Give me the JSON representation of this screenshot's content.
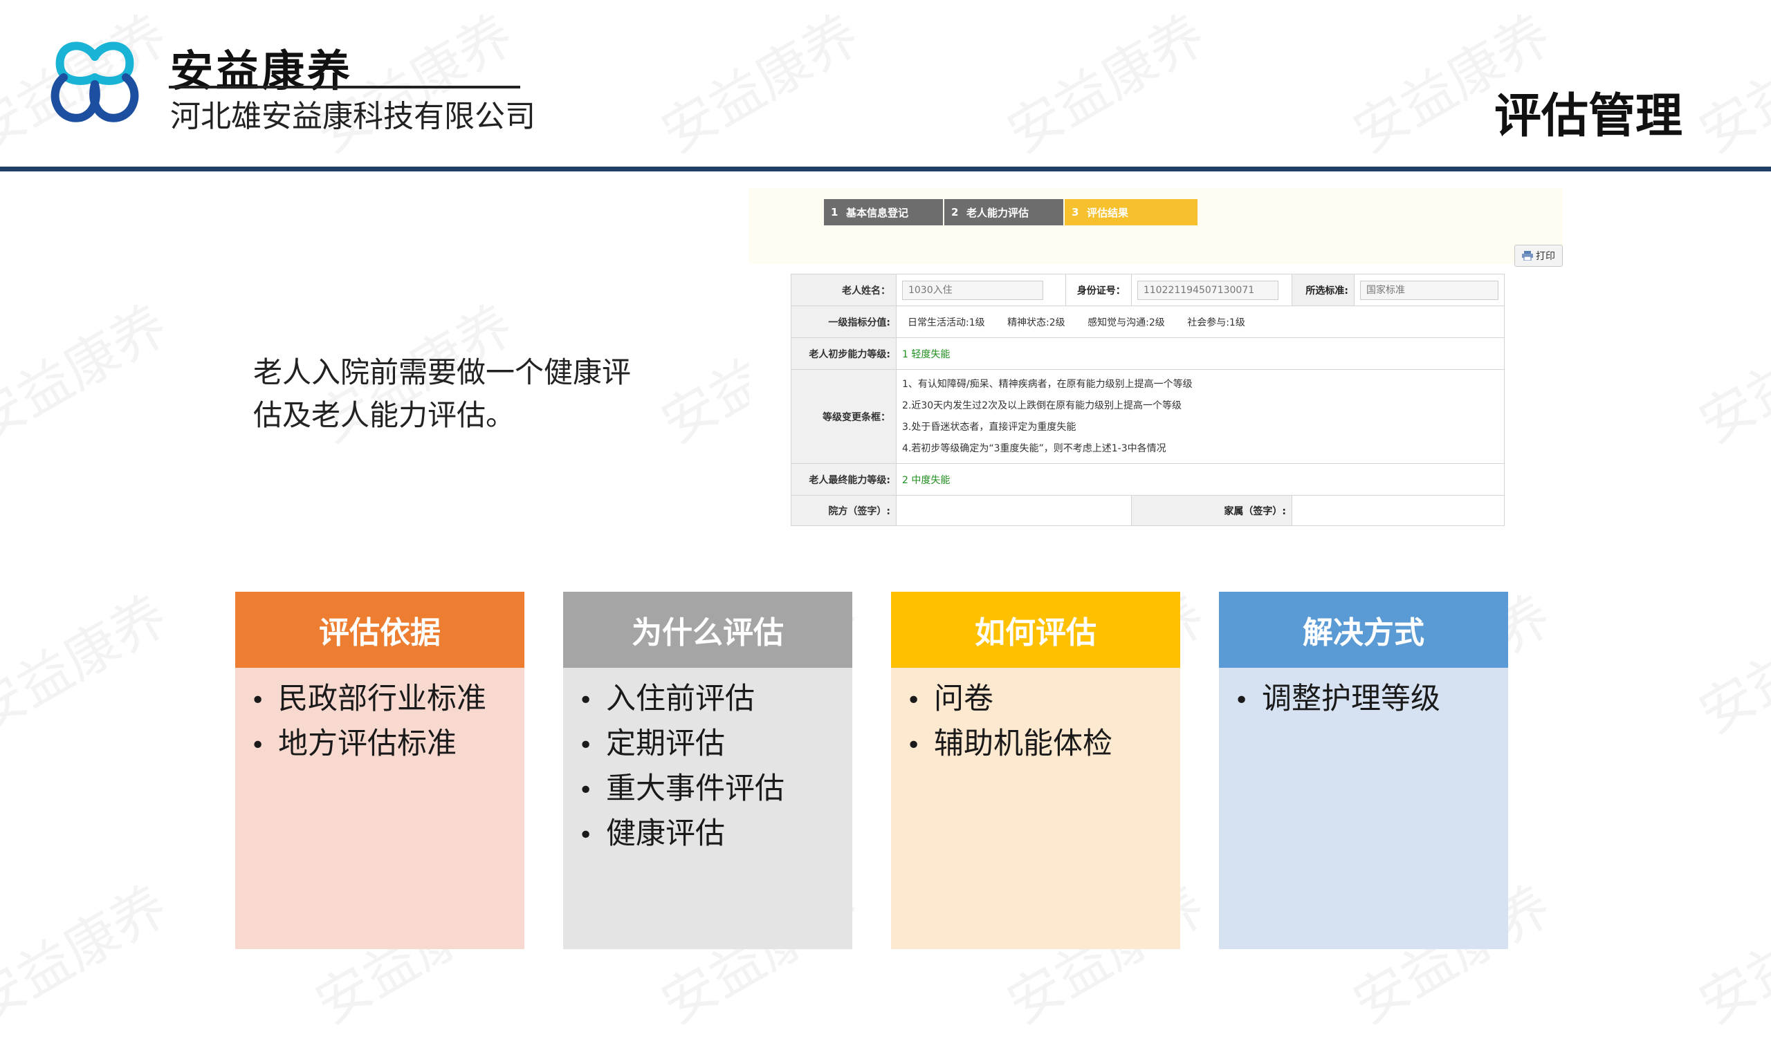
{
  "header": {
    "brand_name": "安益康养",
    "company": "河北雄安益康科技有限公司",
    "page_title": "评估管理",
    "logo_icon": "trefoil-heart-logo-icon",
    "divider_color": "#1f3f66"
  },
  "watermark": "安益康养",
  "intro": "老人入院前需要做一个健康评估及老人能力评估。",
  "screenshot": {
    "steps": [
      {
        "num": "1",
        "label": "基本信息登记",
        "color": "#6d6d6d"
      },
      {
        "num": "2",
        "label": "老人能力评估",
        "color": "#6d6d6d"
      },
      {
        "num": "3",
        "label": "评估结果",
        "color": "#f6c12d"
      }
    ],
    "print_label": "打印",
    "print_icon": "printer-icon",
    "form": {
      "name_label": "老人姓名：",
      "name_value": "1030入住",
      "id_label": "身份证号：",
      "id_value": "110221194507130071",
      "standard_label": "所选标准:",
      "standard_value": "国家标准",
      "scores_label": "一级指标分值:",
      "scores": [
        "日常生活活动:1级",
        "精神状态:2级",
        "感知觉与沟通:2级",
        "社会参与:1级"
      ],
      "initial_label": "老人初步能力等级:",
      "initial_value": "1 轻度失能",
      "conditions_label": "等级变更条框：",
      "conditions": [
        "1、有认知障碍/痴呆、精神疾病者，在原有能力级别上提高一个等级",
        "2.近30天内发生过2次及以上跌倒在原有能力级别上提高一个等级",
        "3.处于昏迷状态者，直接评定为重度失能",
        "4.若初步等级确定为“3重度失能”，则不考虑上述1-3中各情况"
      ],
      "final_label": "老人最终能力等级:",
      "final_value": "2 中度失能",
      "institution_sign_label": "院方（签字）:",
      "family_sign_label": "家属（签字）:"
    }
  },
  "cards": [
    {
      "title": "评估依据",
      "head_color": "#ed7d31",
      "body_color": "#f8d9d0",
      "items": [
        "民政部行业标准",
        "地方评估标准"
      ]
    },
    {
      "title": "为什么评估",
      "head_color": "#a5a5a5",
      "body_color": "#e4e4e4",
      "items": [
        "入住前评估",
        "定期评估",
        "重大事件评估",
        "健康评估"
      ]
    },
    {
      "title": "如何评估",
      "head_color": "#ffc000",
      "body_color": "#fde8d0",
      "items": [
        "问卷",
        "辅助机能体检"
      ]
    },
    {
      "title": "解决方式",
      "head_color": "#5b9bd5",
      "body_color": "#d6e1f1",
      "items": [
        "调整护理等级"
      ]
    }
  ]
}
